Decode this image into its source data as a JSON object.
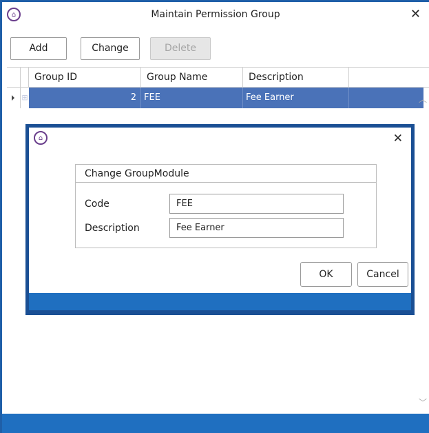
{
  "window": {
    "title": "Maintain Permission Group",
    "close_glyph": "✕"
  },
  "toolbar": {
    "add_label": "Add",
    "change_label": "Change",
    "delete_label": "Delete"
  },
  "grid": {
    "columns": [
      "Group ID",
      "Group Name",
      "Description"
    ],
    "rows": [
      {
        "group_id": "2",
        "group_name": "FEE",
        "description": "Fee Earner"
      }
    ]
  },
  "dialog": {
    "close_glyph": "✕",
    "group_title": "Change GroupModule",
    "code_label": "Code",
    "code_value": "FEE",
    "description_label": "Description",
    "description_value": "Fee Earner",
    "ok_label": "OK",
    "cancel_label": "Cancel"
  },
  "colors": {
    "accent": "#1f6fc0",
    "selected_row": "#4a72b8",
    "dialog_border": "#1a4f94",
    "logo": "#6a3e8c"
  },
  "icons": {
    "app_logo": "institution-logo-icon",
    "row_pointer": "row-pointer-icon",
    "expander": "expand-icon"
  }
}
